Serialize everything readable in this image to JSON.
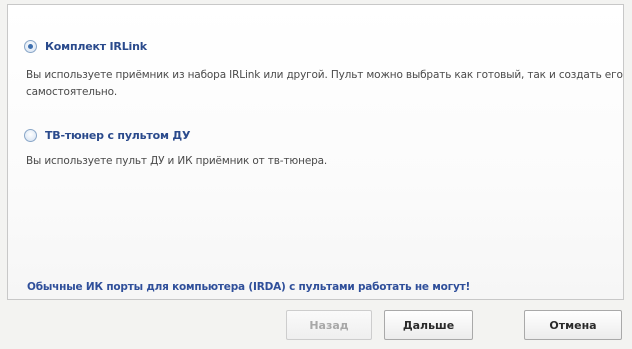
{
  "options": [
    {
      "label": "Комплект IRLink",
      "description": "Вы используете приёмник из набора IRLink или другой. Пульт можно выбрать как готовый, так и создать его самостоятельно.",
      "selected": true
    },
    {
      "label": "ТВ-тюнер с пультом ДУ",
      "description": "Вы используете пульт ДУ и ИК приёмник от тв-тюнера.",
      "selected": false
    }
  ],
  "note": "Обычные ИК порты для компьютера (IRDA) с пультами работать не могут!",
  "buttons": {
    "back": "Назад",
    "next": "Дальше",
    "cancel": "Отмена"
  }
}
